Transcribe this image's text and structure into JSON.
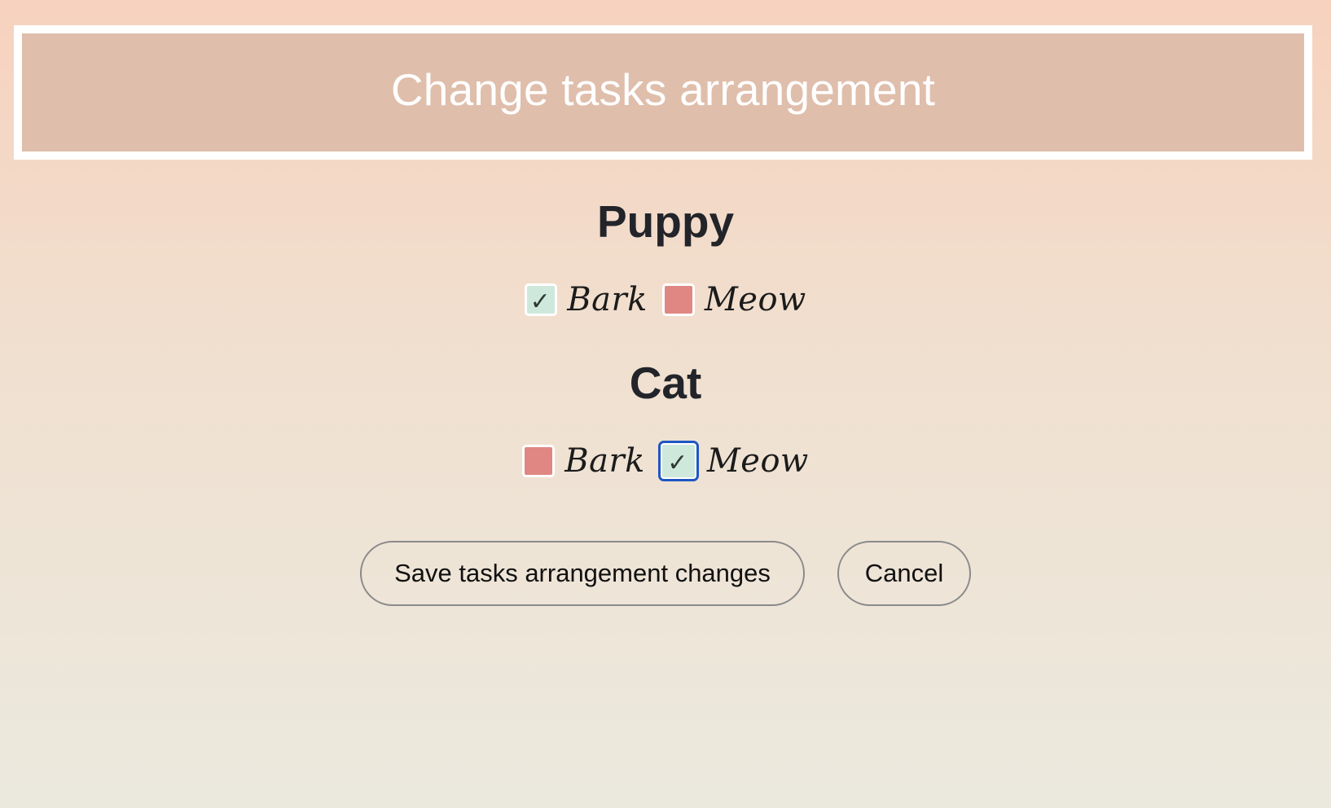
{
  "header": {
    "title": "Change tasks arrangement"
  },
  "groups": [
    {
      "title": "Puppy",
      "options": [
        {
          "label": "Bark",
          "checked": true,
          "tick": "✓"
        },
        {
          "label": "Meow",
          "checked": false
        }
      ]
    },
    {
      "title": "Cat",
      "options": [
        {
          "label": "Bark",
          "checked": false
        },
        {
          "label": "Meow",
          "checked": true,
          "tick": "✓"
        }
      ]
    }
  ],
  "actions": {
    "save_label": "Save tasks arrangement changes",
    "cancel_label": "Cancel"
  },
  "colors": {
    "header_bg": "#dfbeab",
    "checked_bg": "#cfe8dc",
    "unchecked_bg": "#e08783",
    "focus_ring": "#1f56c3"
  }
}
